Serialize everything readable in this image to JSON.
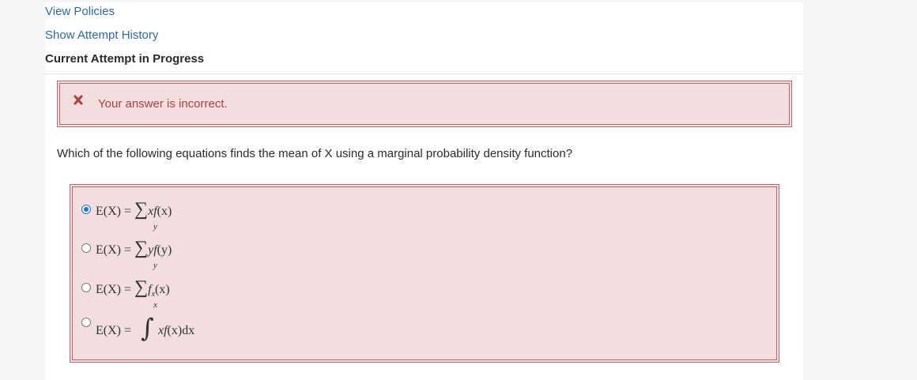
{
  "nav": {
    "view_policies": "View Policies",
    "show_attempt_history": "Show Attempt History",
    "attempt_status": "Current Attempt in Progress"
  },
  "feedback": {
    "message": "Your answer is incorrect.",
    "icon": "x-icon",
    "color": "#a94442",
    "background": "#f2dede"
  },
  "question": {
    "text": "Which of the following equations finds the mean of X using a marginal probability density function?"
  },
  "options": [
    {
      "lhs": "E(X) =",
      "sum": "∑",
      "body_a": "xf",
      "body_b": "(x)",
      "index": "y",
      "selected": true
    },
    {
      "lhs": "E(X) =",
      "sum": "∑",
      "body_a": "yf",
      "body_b": "(y)",
      "index": "y",
      "selected": false
    },
    {
      "lhs": "E(X) =",
      "sum": "∑",
      "body_a": "f",
      "body_sub": "x",
      "body_b": "(x)",
      "index": "x",
      "selected": false
    },
    {
      "lhs": "E(X) =",
      "integral": "∫",
      "body_a": "xf",
      "body_b": "(x)dx",
      "selected": false
    }
  ],
  "colors": {
    "link": "#2f6aa8",
    "radio_selected": "#1a73e8",
    "error_border": "#b7666e"
  }
}
